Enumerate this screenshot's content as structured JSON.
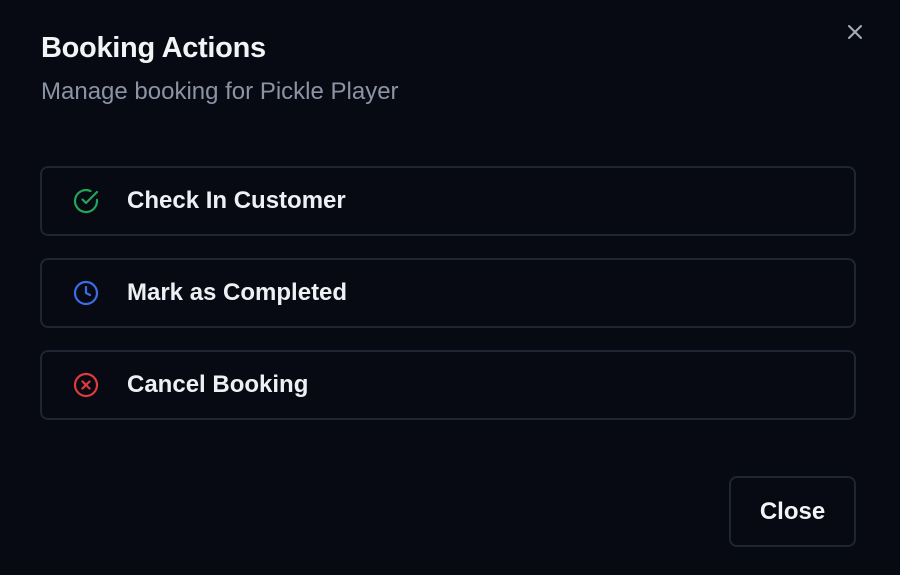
{
  "dialog": {
    "title": "Booking Actions",
    "subtitle": "Manage booking for Pickle Player"
  },
  "actions": [
    {
      "label": "Check In Customer",
      "icon": "check-circle-icon",
      "color": "#22a559"
    },
    {
      "label": "Mark as Completed",
      "icon": "clock-icon",
      "color": "#3b6ee6"
    },
    {
      "label": "Cancel Booking",
      "icon": "x-circle-icon",
      "color": "#e03a3a"
    }
  ],
  "footer": {
    "close_label": "Close"
  },
  "colors": {
    "background": "#070a13",
    "border": "#1f2533",
    "text": "#f3f4f6",
    "muted": "#8b93a4"
  }
}
